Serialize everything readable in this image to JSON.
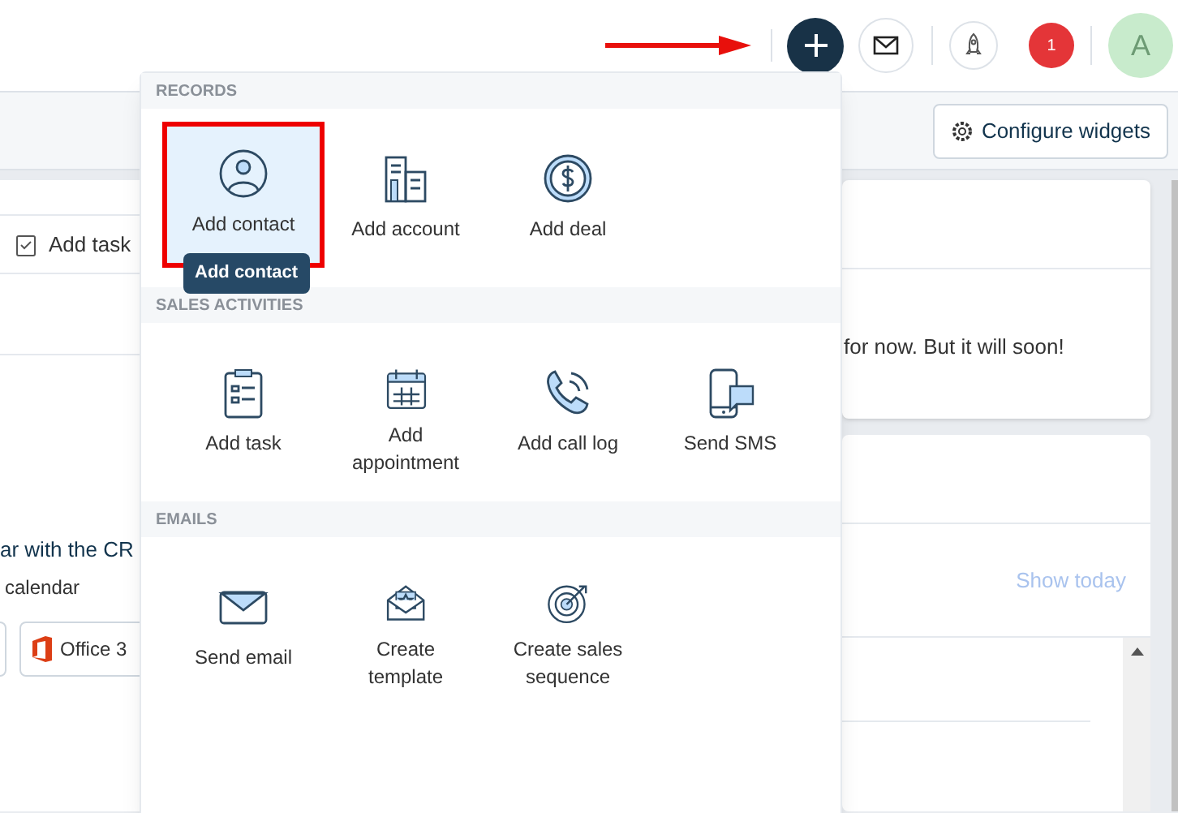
{
  "header": {
    "notification_count": "1",
    "avatar_initial": "A"
  },
  "toolbar": {
    "configure_button": "Configure widgets"
  },
  "left_panel": {
    "task_button": "Add task",
    "calendar_title": "ar with the CR",
    "calendar_subtitle": "calendar",
    "office_button": "Office 3"
  },
  "right_panel": {
    "empty_message": "for now. But it will soon!",
    "show_today_link": "Show today"
  },
  "quick_add_menu": {
    "sections": [
      {
        "title": "RECORDS",
        "items": [
          {
            "label": "Add contact",
            "kind": "contact",
            "selected": true
          },
          {
            "label": "Add account",
            "kind": "account",
            "selected": false
          },
          {
            "label": "Add deal",
            "kind": "deal",
            "selected": false
          }
        ]
      },
      {
        "title": "SALES ACTIVITIES",
        "items": [
          {
            "label": "Add task",
            "kind": "task",
            "selected": false
          },
          {
            "label": "Add appointment",
            "kind": "calendar",
            "selected": false
          },
          {
            "label": "Add call log",
            "kind": "phone",
            "selected": false
          },
          {
            "label": "Send SMS",
            "kind": "sms",
            "selected": false
          }
        ]
      },
      {
        "title": "EMAILS",
        "items": [
          {
            "label": "Send email",
            "kind": "email",
            "selected": false
          },
          {
            "label": "Create template",
            "kind": "template",
            "selected": false
          },
          {
            "label": "Create sales sequence",
            "kind": "target",
            "selected": false
          }
        ]
      }
    ],
    "tooltip": "Add contact"
  }
}
